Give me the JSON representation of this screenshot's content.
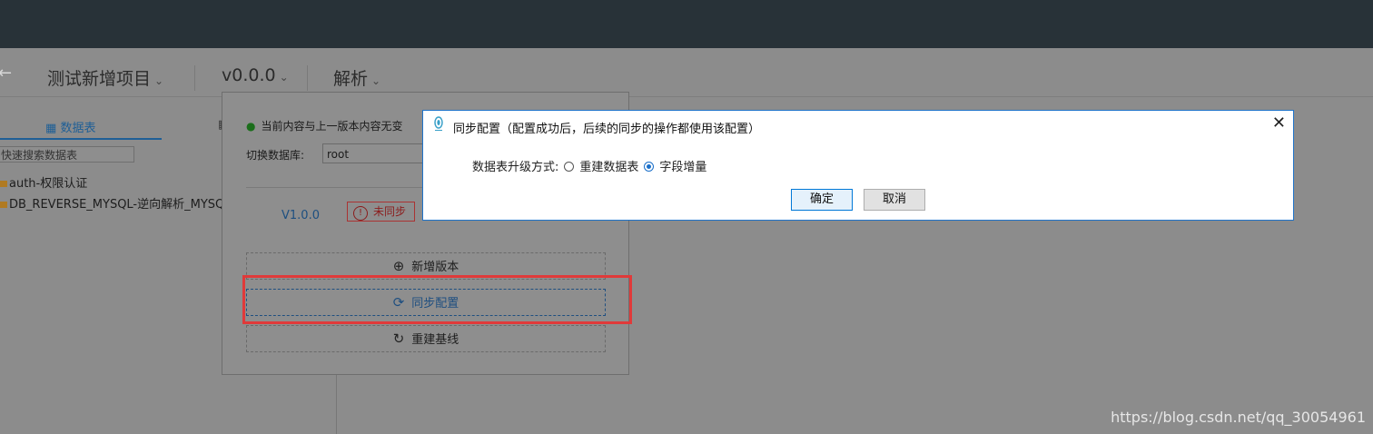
{
  "header": {
    "project": "测试新增项目",
    "version": "v0.0.0",
    "module": "解析"
  },
  "sidebar": {
    "tab_tables": "数据表",
    "search_placeholder": "快速搜索数据表",
    "items": [
      {
        "label": "auth-权限认证"
      },
      {
        "label": "DB_REVERSE_MYSQL-逆向解析_MYSQ"
      }
    ]
  },
  "popover": {
    "status": "当前内容与上一版本内容无变",
    "db_label": "切换数据库:",
    "db_value": "root",
    "version": "V1.0.0",
    "badge": "未同步",
    "btn_add_version": "新增版本",
    "btn_sync_config": "同步配置",
    "btn_rebuild_baseline": "重建基线"
  },
  "dialog": {
    "title": "同步配置（配置成功后，后续的同步的操作都使用该配置）",
    "upgrade_label": "数据表升级方式:",
    "option_rebuild": "重建数据表",
    "option_incremental": "字段增量",
    "selected": "字段增量",
    "ok": "确定",
    "cancel": "取消"
  },
  "watermark": "https://blog.csdn.net/qq_30054961",
  "colors": {
    "accent": "#1f73c9",
    "highlight": "#e03a3a",
    "topbar": "#283238"
  }
}
